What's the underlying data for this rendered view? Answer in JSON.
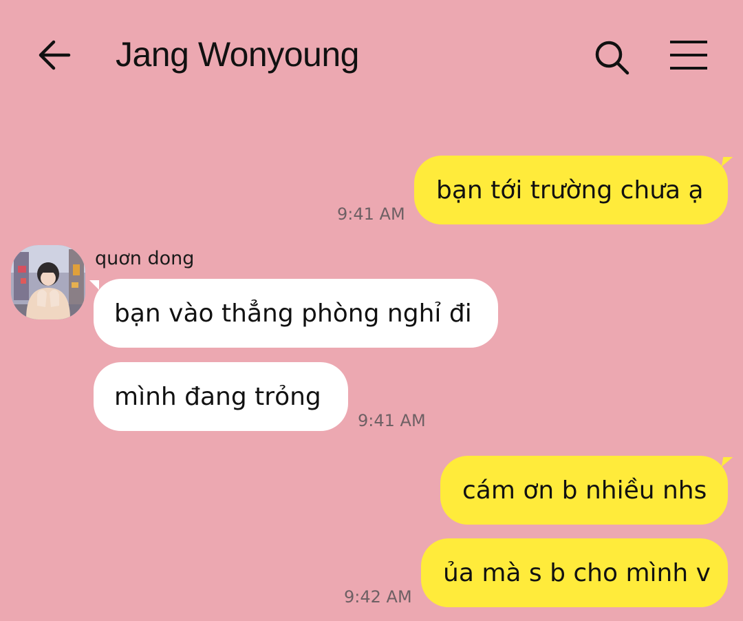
{
  "header": {
    "title": "Jang Wonyoung",
    "back_icon": "arrow-left-icon",
    "search_icon": "search-icon",
    "menu_icon": "hamburger-menu-icon"
  },
  "colors": {
    "background": "#eca8b1",
    "outgoing_bubble": "#ffeb3b",
    "incoming_bubble": "#ffffff"
  },
  "messages": [
    {
      "direction": "outgoing",
      "text": "bạn tới trường chưa ạ",
      "time": "9:41 AM"
    },
    {
      "direction": "incoming",
      "sender": "quơn dong",
      "text": "bạn vào thẳng phòng nghỉ đi"
    },
    {
      "direction": "incoming",
      "text": "mình đang trỏng",
      "time": "9:41 AM"
    },
    {
      "direction": "outgoing",
      "text": "cám ơn b nhiều nhs"
    },
    {
      "direction": "outgoing",
      "text": "ủa mà s b cho mình v",
      "time": "9:42 AM"
    }
  ]
}
